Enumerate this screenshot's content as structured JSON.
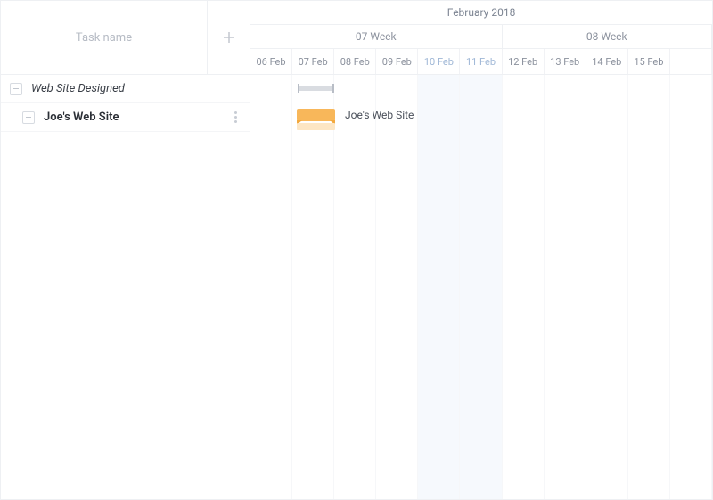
{
  "left": {
    "header": "Task name"
  },
  "tasks": [
    {
      "name": "Web Site Designed",
      "type": "summary"
    },
    {
      "name": "Joe's Web Site",
      "type": "task"
    }
  ],
  "timeline": {
    "month": "February 2018",
    "weeks": [
      {
        "label": "07 Week",
        "span_days": 6
      },
      {
        "label": "08 Week",
        "span_days": 5
      }
    ],
    "days": [
      {
        "label": "06 Feb",
        "weekend": false
      },
      {
        "label": "07 Feb",
        "weekend": false
      },
      {
        "label": "08 Feb",
        "weekend": false
      },
      {
        "label": "09 Feb",
        "weekend": false
      },
      {
        "label": "10 Feb",
        "weekend": true
      },
      {
        "label": "11 Feb",
        "weekend": true
      },
      {
        "label": "12 Feb",
        "weekend": false
      },
      {
        "label": "13 Feb",
        "weekend": false
      },
      {
        "label": "14 Feb",
        "weekend": false
      },
      {
        "label": "15 Feb",
        "weekend": false
      },
      {
        "label": "",
        "weekend": false
      }
    ],
    "bars": {
      "summary": {
        "row": 0,
        "start_day": 1,
        "span": 1
      },
      "task": {
        "row": 1,
        "start_day": 1,
        "span": 1,
        "label": "Joe's Web Site"
      }
    },
    "day_width": 49
  }
}
